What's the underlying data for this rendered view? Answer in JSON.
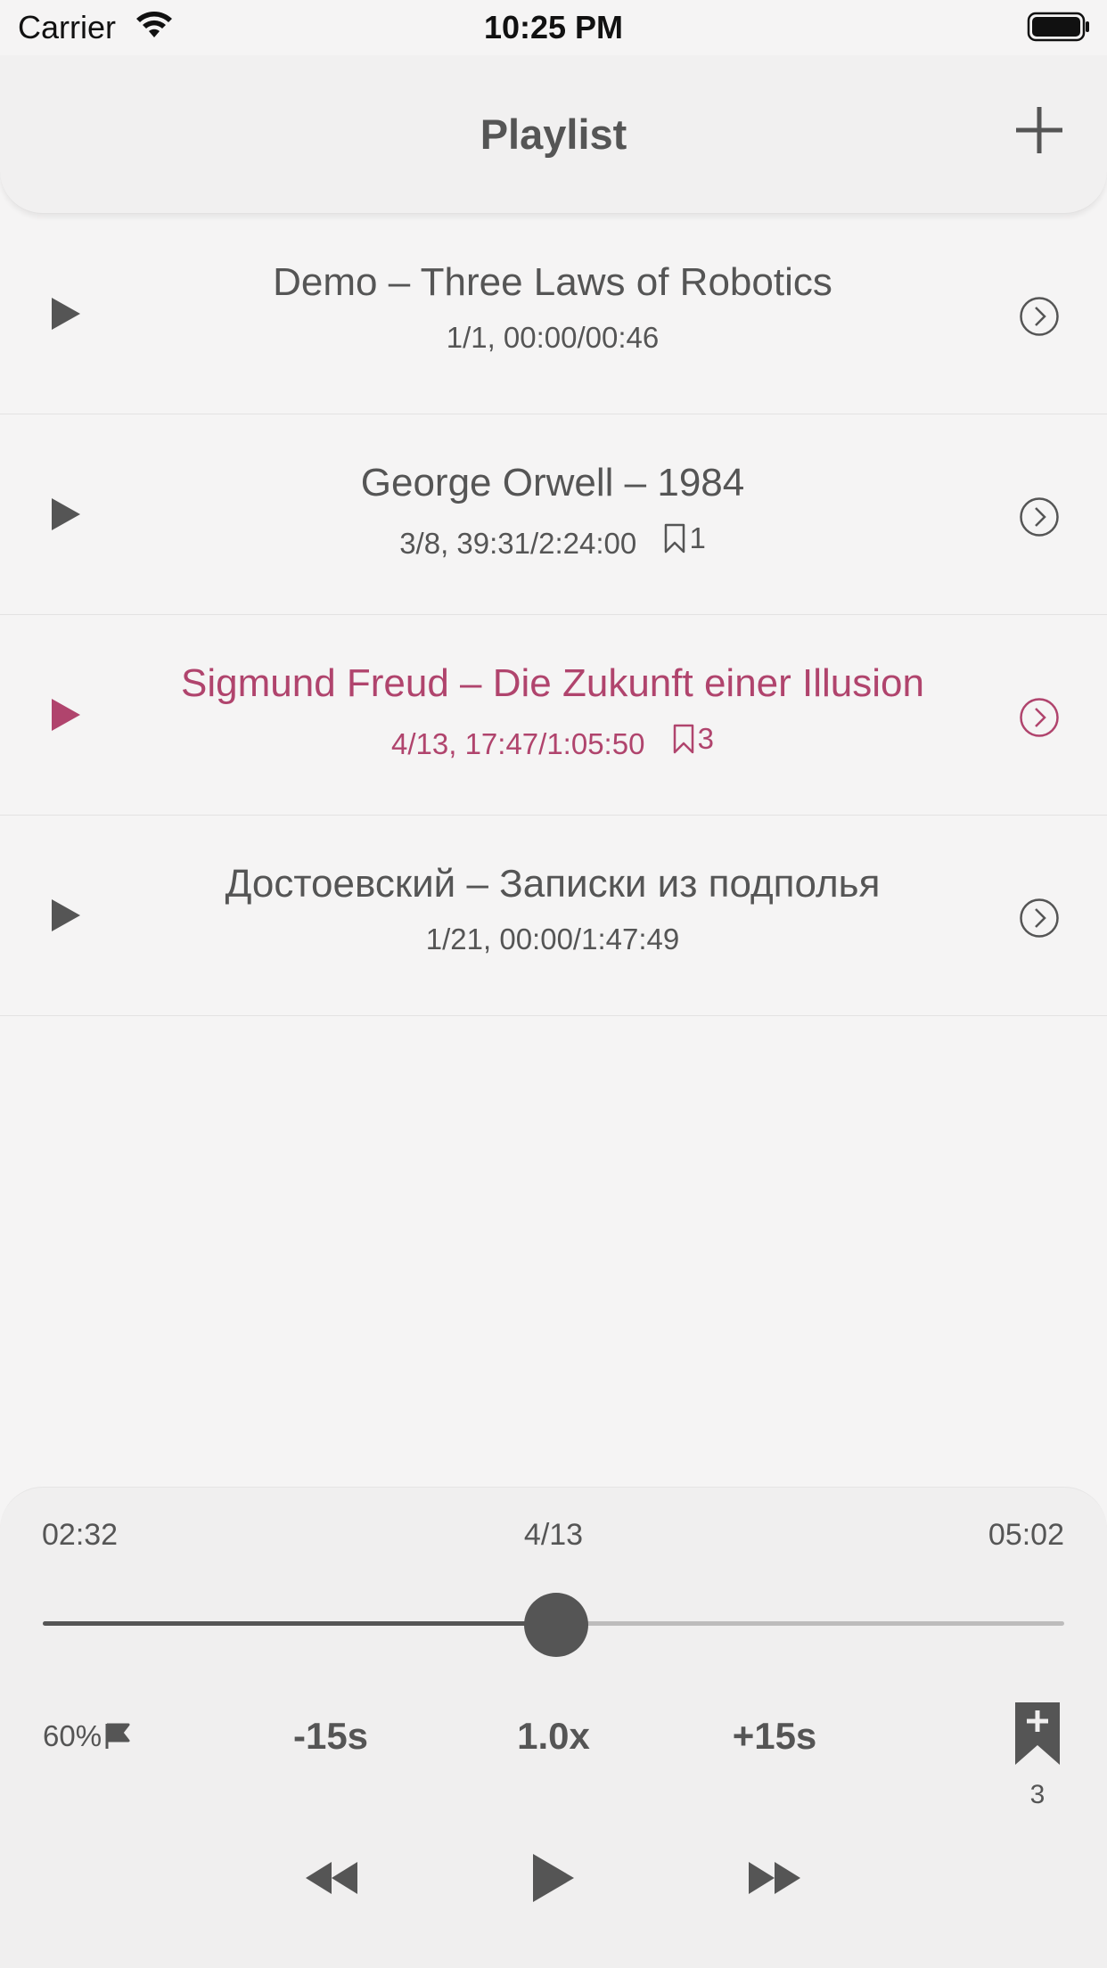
{
  "status_bar": {
    "carrier": "Carrier",
    "time": "10:25 PM"
  },
  "nav": {
    "title": "Playlist",
    "add_icon": "plus-icon"
  },
  "colors": {
    "accent": "#b0446d",
    "text": "#555555",
    "background": "#f5f4f4"
  },
  "playlist": [
    {
      "title": "Demo – Three Laws of Robotics",
      "meta": "1/1, 00:00/00:46",
      "bookmarks": "",
      "active": false
    },
    {
      "title": "George Orwell – 1984",
      "meta": "3/8, 39:31/2:24:00",
      "bookmarks": "1",
      "active": false
    },
    {
      "title": "Sigmund Freud – Die Zukunft einer Illusion",
      "meta": "4/13, 17:47/1:05:50",
      "bookmarks": "3",
      "active": true
    },
    {
      "title": "Достоевский – Записки из подполья",
      "meta": "1/21, 00:00/1:47:49",
      "bookmarks": "",
      "active": false
    }
  ],
  "player": {
    "elapsed": "02:32",
    "track": "4/13",
    "remaining": "05:02",
    "progress": 0.503,
    "volume": "60%",
    "skip_back": "-15s",
    "rate": "1.0x",
    "skip_forward": "+15s",
    "bookmark_count": "3"
  }
}
